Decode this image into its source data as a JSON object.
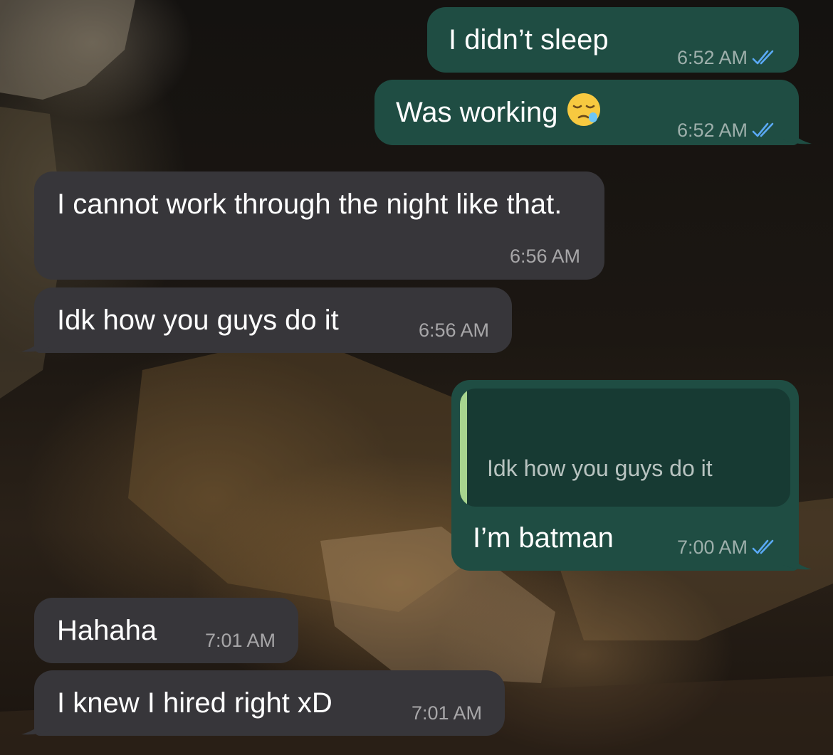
{
  "chat": {
    "messages": [
      {
        "direction": "outgoing",
        "text": "I didn’t sleep",
        "time": "6:52 AM",
        "status_icon": "double-check-read-icon"
      },
      {
        "direction": "outgoing",
        "text": "Was working",
        "emoji": "sleepy-face-emoji",
        "time": "6:52 AM",
        "status_icon": "double-check-read-icon"
      },
      {
        "direction": "incoming",
        "text": "I cannot work through the night like that.",
        "time": "6:56 AM"
      },
      {
        "direction": "incoming",
        "text": "Idk how you guys do it",
        "time": "6:56 AM"
      },
      {
        "direction": "outgoing",
        "quoted_text": "Idk how you guys do it",
        "text": "I’m batman",
        "time": "7:00 AM",
        "status_icon": "double-check-read-icon"
      },
      {
        "direction": "incoming",
        "text": "Hahaha",
        "time": "7:01 AM"
      },
      {
        "direction": "incoming",
        "text": "I knew I hired right xD",
        "time": "7:01 AM"
      }
    ]
  },
  "colors": {
    "outgoing_bubble": "#1f4d43",
    "incoming_bubble": "#37363a",
    "quote_background": "#173a33",
    "quote_accent": "#a7d58f",
    "read_ticks": "#5aa9f5"
  }
}
